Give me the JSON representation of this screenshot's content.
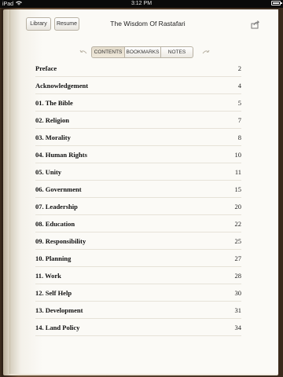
{
  "status_bar": {
    "device": "iPad",
    "time": "3:12 PM"
  },
  "toolbar": {
    "library_label": "Library",
    "resume_label": "Resume",
    "title": "The Wisdom Of Rastafari"
  },
  "tabs": [
    {
      "label": "CONTENTS",
      "active": true
    },
    {
      "label": "BOOKMARKS",
      "active": false
    },
    {
      "label": "NOTES",
      "active": false
    }
  ],
  "contents": [
    {
      "title": "Preface",
      "page": "2"
    },
    {
      "title": "Acknowledgement",
      "page": "4"
    },
    {
      "title": "01. The Bible",
      "page": "5"
    },
    {
      "title": "02. Religion",
      "page": "7"
    },
    {
      "title": "03. Morality",
      "page": "8"
    },
    {
      "title": "04. Human Rights",
      "page": "10"
    },
    {
      "title": "05. Unity",
      "page": "11"
    },
    {
      "title": "06. Government",
      "page": "15"
    },
    {
      "title": "07. Leadership",
      "page": "20"
    },
    {
      "title": "08. Education",
      "page": "22"
    },
    {
      "title": "09. Responsibility",
      "page": "25"
    },
    {
      "title": "10. Planning",
      "page": "27"
    },
    {
      "title": "11. Work",
      "page": "28"
    },
    {
      "title": "12. Self Help",
      "page": "30"
    },
    {
      "title": "13. Development",
      "page": "31"
    },
    {
      "title": "14. Land Policy",
      "page": "34"
    }
  ],
  "icons": {
    "wifi": "wifi-icon",
    "battery": "battery-icon",
    "share": "share-icon",
    "prev": "curved-arrow-left-icon",
    "next": "curved-arrow-right-icon"
  },
  "colors": {
    "page_background": "#fbfaf6",
    "book_leather": "#3a2a1c",
    "active_tab": "#e4dccb"
  }
}
